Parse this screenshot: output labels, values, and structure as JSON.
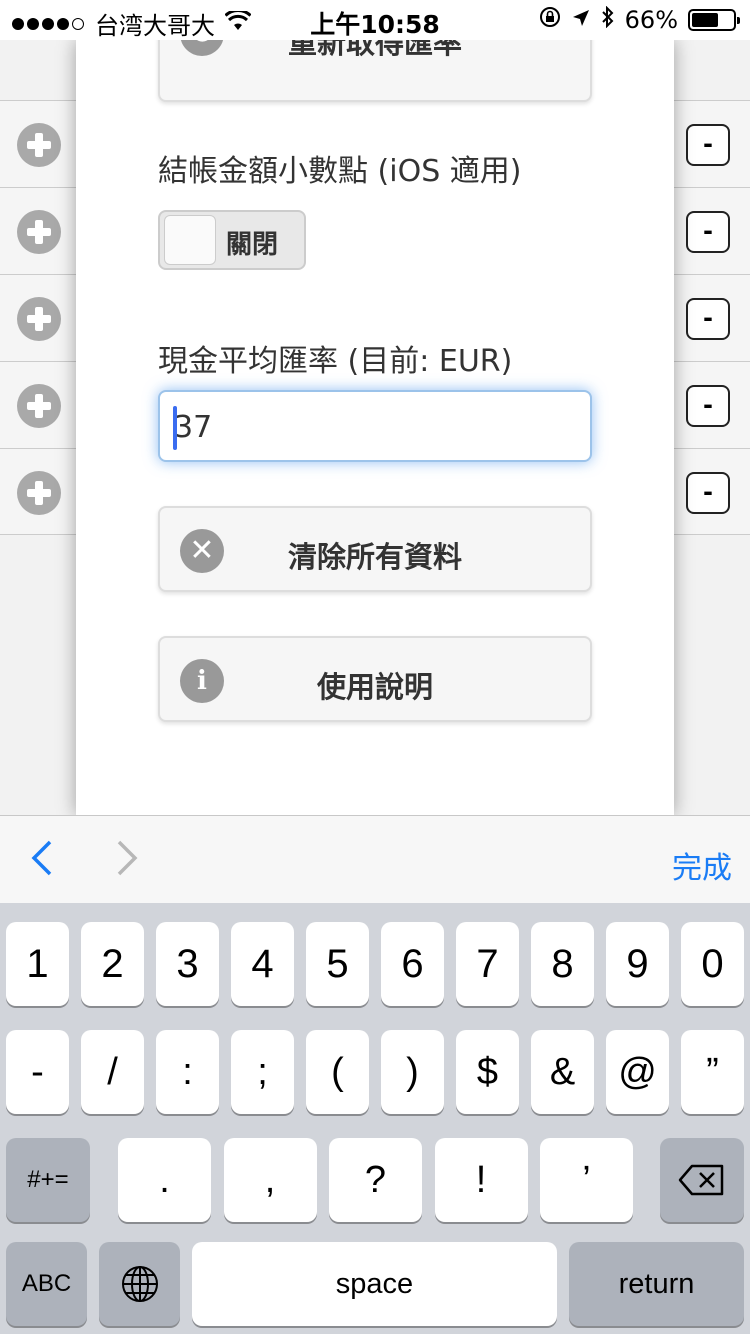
{
  "status_bar": {
    "carrier": "台湾大哥大",
    "wifi_icon": "wifi-icon",
    "time": "上午10:58",
    "lock_icon": "orientation-lock-icon",
    "location_icon": "location-arrow-icon",
    "bluetooth_icon": "bluetooth-icon",
    "battery_percent": "66%",
    "battery_level": 0.66
  },
  "background_list": {
    "plus_icon": "plus-circle-icon",
    "minus_label": "-",
    "row_count": 5
  },
  "panel": {
    "refresh_button": "重新取得匯率",
    "decimal_label": "結帳金額小數點 (iOS 適用)",
    "decimal_toggle_state": "關閉",
    "rate_label": "現金平均匯率 (目前: EUR)",
    "rate_value": "37",
    "clear_button": "清除所有資料",
    "help_button": "使用說明"
  },
  "accessory_bar": {
    "prev_icon": "chevron-left-icon",
    "next_icon": "chevron-right-icon",
    "done": "完成"
  },
  "keyboard": {
    "row1": [
      "1",
      "2",
      "3",
      "4",
      "5",
      "6",
      "7",
      "8",
      "9",
      "0"
    ],
    "row2": [
      "-",
      "/",
      ":",
      ";",
      "(",
      ")",
      "$",
      "&",
      "@",
      "”"
    ],
    "row3_toggle": "#+=",
    "row3": [
      ".",
      ",",
      "?",
      "!",
      "’"
    ],
    "delete_icon": "backspace-icon",
    "abc": "ABC",
    "globe_icon": "globe-icon",
    "space": "space",
    "return": "return"
  }
}
